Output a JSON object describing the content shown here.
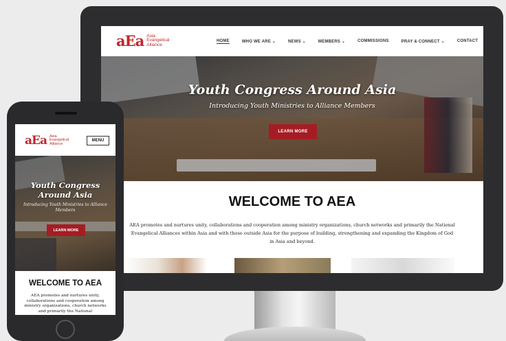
{
  "brand": {
    "logo_mark": "aEa",
    "logo_line1": "Asia",
    "logo_line2": "Evangelical",
    "logo_line3": "Alliance",
    "accent_color": "#a51d23"
  },
  "desktop": {
    "nav": [
      {
        "label": "HOME"
      },
      {
        "label": "WHO WE ARE ⌄"
      },
      {
        "label": "NEWS ⌄"
      },
      {
        "label": "MEMBERS ⌄"
      },
      {
        "label": "COMMISSIONS"
      },
      {
        "label": "PRAY & CONNECT ⌄"
      },
      {
        "label": "CONTACT"
      }
    ],
    "hero": {
      "title": "Youth Congress Around Asia",
      "subtitle": "Introducing Youth Ministries to Alliance Members",
      "button": "LEARN MORE"
    },
    "welcome_title": "WELCOME TO AEA",
    "welcome_text": "AEA promotes and nurtures unity, collaborations and cooperation among ministry organizations, church networks and primarily the National Evangelical Alliances within Asia and with those outside Asia for the purpose of building, strengthening and expanding the Kingdom of God in Asia and beyond."
  },
  "mobile": {
    "menu_button": "MENU",
    "hero": {
      "title": "Youth Congress Around Asia",
      "subtitle": "Introducing Youth Ministries to Alliance Members",
      "button": "LEARN MORE"
    },
    "welcome_title": "WELCOME TO AEA",
    "welcome_text": "AEA promotes and nurtures unity, collaborations and cooperation among ministry organizations, church networks and primarily the National"
  }
}
